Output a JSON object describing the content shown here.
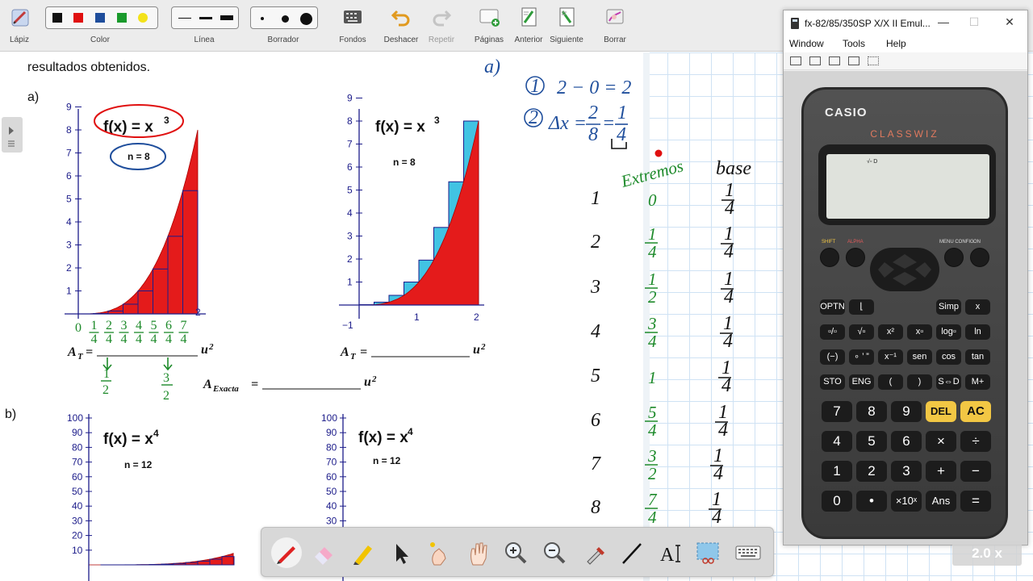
{
  "toolbar": {
    "lapiz_label": "Lápiz",
    "color_label": "Color",
    "linea_label": "Línea",
    "borrador_label": "Borrador",
    "fondos_label": "Fondos",
    "deshacer_label": "Deshacer",
    "repetir_label": "Repetir",
    "paginas_label": "Páginas",
    "anterior_label": "Anterior",
    "siguiente_label": "Siguiente",
    "borrar_label": "Borrar",
    "colors": [
      "#111111",
      "#e01010",
      "#1f4e9c",
      "#1a9a2c",
      "#f3e21a"
    ]
  },
  "document": {
    "intro_text": "resultados obtenidos.",
    "part_a": "a)",
    "part_b": "b)",
    "graph1": {
      "title": "f(x) = x",
      "exp": "3",
      "n_label": "n = 8"
    },
    "graph2": {
      "title": "f(x) = x",
      "exp": "3",
      "n_label": "n = 8"
    },
    "graph3": {
      "title": "f(x) = x",
      "exp": "4",
      "n_label": "n = 12"
    },
    "graph4": {
      "title": "f(x) = x",
      "exp": "4",
      "n_label": "n = 12"
    },
    "at_label": "A",
    "at_sub": "T",
    "aexacta_label": "A",
    "aexacta_sub": "Exacta",
    "unit": "u",
    "unit_exp": "2",
    "eq": "=",
    "yticks_small": [
      "9",
      "8",
      "7",
      "6",
      "5",
      "4",
      "3",
      "2",
      "1"
    ],
    "yticks_big": [
      "100",
      "90",
      "80",
      "70",
      "60",
      "50",
      "40",
      "30",
      "20",
      "10"
    ],
    "xtick_1": "1",
    "xtick_2": "2",
    "xtick_neg": "−1"
  },
  "handwriting": {
    "a_label": "a)",
    "step1": "2 − 0 = 2",
    "step1_num": "1",
    "step2_num": "2",
    "step2_lhs": "Δx =",
    "extremos": "Extremos",
    "base": "base",
    "row_index": [
      "1",
      "2",
      "3",
      "4",
      "5",
      "6",
      "7",
      "8"
    ],
    "extremes": [
      "0",
      "1/4",
      "1/2",
      "3/4",
      "1",
      "5/4",
      "3/2",
      "7/4"
    ],
    "bases": [
      "1/4",
      "1/4",
      "1/4",
      "1/4",
      "1/4",
      "1/4",
      "1/4",
      "1/4"
    ],
    "x_marks": [
      "0",
      "1/4",
      "2/4",
      "3/4",
      "4/4",
      "5/4",
      "6/4",
      "7/4"
    ]
  },
  "calculator": {
    "window_title": "fx-82/85/350SP X/X II Emul...",
    "menu": [
      "Window",
      "Tools",
      "Help"
    ],
    "brand": "CASIO",
    "model": "CLASSWIZ",
    "screen_indicator": "√▫ D",
    "top_labels": {
      "shift": "SHIFT",
      "alpha": "ALPHA",
      "menu": "MENU CONFIG",
      "on": "ON"
    },
    "func_rows": [
      [
        "OPTN",
        "⌊",
        "",
        "",
        "Simp",
        "x"
      ],
      [
        "▫/▫",
        "√▫",
        "x²",
        "x▫",
        "log▫",
        "ln"
      ],
      [
        "(−)",
        "∘ ’ ”",
        "x⁻¹",
        "sen",
        "cos",
        "tan"
      ],
      [
        "STO",
        "ENG",
        "(",
        ")",
        "S⇔D",
        "M+"
      ]
    ],
    "num_rows": [
      [
        "7",
        "8",
        "9",
        "DEL",
        "AC"
      ],
      [
        "4",
        "5",
        "6",
        "×",
        "÷"
      ],
      [
        "1",
        "2",
        "3",
        "+",
        "−"
      ],
      [
        "0",
        "•",
        "×10ˣ",
        "Ans",
        "="
      ]
    ]
  },
  "zoom": "2.0 x"
}
